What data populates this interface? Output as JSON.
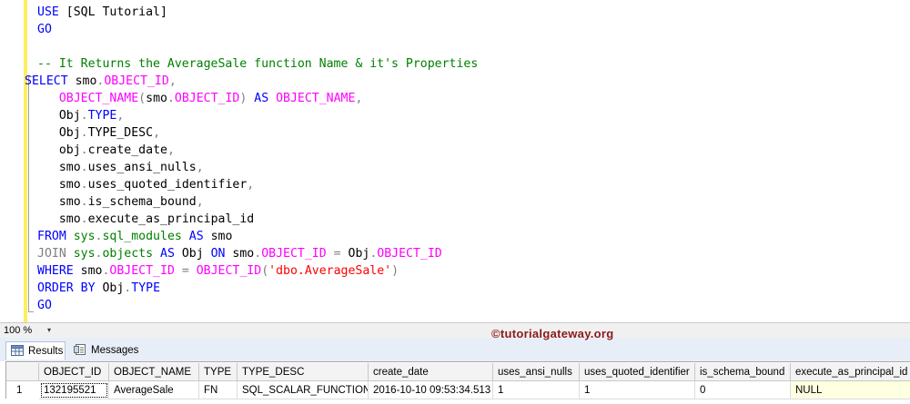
{
  "editor": {
    "lines": [
      {
        "indent": "",
        "tokens": [
          {
            "t": "USE",
            "c": "kw"
          },
          {
            "t": " [SQL Tutorial]",
            "c": "plain"
          }
        ]
      },
      {
        "indent": "",
        "tokens": [
          {
            "t": "GO",
            "c": "kw"
          }
        ]
      },
      {
        "indent": "",
        "tokens": []
      },
      {
        "indent": "",
        "tokens": [
          {
            "t": "-- It Returns the AverageSale function Name & it's Properties",
            "c": "cmt"
          }
        ]
      },
      {
        "indent": "",
        "tokens": [
          {
            "t": "SELECT",
            "c": "kw"
          },
          {
            "t": " smo",
            "c": "plain"
          },
          {
            "t": ".",
            "c": "gray"
          },
          {
            "t": "OBJECT_ID",
            "c": "fn"
          },
          {
            "t": ",",
            "c": "gray"
          }
        ]
      },
      {
        "indent": "   ",
        "tokens": [
          {
            "t": "OBJECT_NAME",
            "c": "fn"
          },
          {
            "t": "(",
            "c": "gray"
          },
          {
            "t": "smo",
            "c": "plain"
          },
          {
            "t": ".",
            "c": "gray"
          },
          {
            "t": "OBJECT_ID",
            "c": "fn"
          },
          {
            "t": ")",
            "c": "gray"
          },
          {
            "t": " AS ",
            "c": "kw"
          },
          {
            "t": "OBJECT_NAME",
            "c": "fn"
          },
          {
            "t": ",",
            "c": "gray"
          }
        ]
      },
      {
        "indent": "   ",
        "tokens": [
          {
            "t": "Obj",
            "c": "plain"
          },
          {
            "t": ".",
            "c": "gray"
          },
          {
            "t": "TYPE",
            "c": "kw"
          },
          {
            "t": ",",
            "c": "gray"
          }
        ]
      },
      {
        "indent": "   ",
        "tokens": [
          {
            "t": "Obj",
            "c": "plain"
          },
          {
            "t": ".",
            "c": "gray"
          },
          {
            "t": "TYPE_DESC",
            "c": "plain"
          },
          {
            "t": ",",
            "c": "gray"
          }
        ]
      },
      {
        "indent": "   ",
        "tokens": [
          {
            "t": "obj",
            "c": "plain"
          },
          {
            "t": ".",
            "c": "gray"
          },
          {
            "t": "create_date",
            "c": "plain"
          },
          {
            "t": ",",
            "c": "gray"
          }
        ]
      },
      {
        "indent": "   ",
        "tokens": [
          {
            "t": "smo",
            "c": "plain"
          },
          {
            "t": ".",
            "c": "gray"
          },
          {
            "t": "uses_ansi_nulls",
            "c": "plain"
          },
          {
            "t": ",",
            "c": "gray"
          }
        ]
      },
      {
        "indent": "   ",
        "tokens": [
          {
            "t": "smo",
            "c": "plain"
          },
          {
            "t": ".",
            "c": "gray"
          },
          {
            "t": "uses_quoted_identifier",
            "c": "plain"
          },
          {
            "t": ",",
            "c": "gray"
          }
        ]
      },
      {
        "indent": "   ",
        "tokens": [
          {
            "t": "smo",
            "c": "plain"
          },
          {
            "t": ".",
            "c": "gray"
          },
          {
            "t": "is_schema_bound",
            "c": "plain"
          },
          {
            "t": ",",
            "c": "gray"
          }
        ]
      },
      {
        "indent": "   ",
        "tokens": [
          {
            "t": "smo",
            "c": "plain"
          },
          {
            "t": ".",
            "c": "gray"
          },
          {
            "t": "execute_as_principal_id",
            "c": "plain"
          }
        ]
      },
      {
        "indent": "",
        "tokens": [
          {
            "t": "FROM ",
            "c": "kw"
          },
          {
            "t": "sys",
            "c": "sys"
          },
          {
            "t": ".",
            "c": "gray"
          },
          {
            "t": "sql_modules",
            "c": "sys"
          },
          {
            "t": " AS ",
            "c": "kw"
          },
          {
            "t": "smo",
            "c": "plain"
          }
        ]
      },
      {
        "indent": "",
        "tokens": [
          {
            "t": "JOIN ",
            "c": "gray"
          },
          {
            "t": "sys",
            "c": "sys"
          },
          {
            "t": ".",
            "c": "gray"
          },
          {
            "t": "objects",
            "c": "sys"
          },
          {
            "t": " AS ",
            "c": "kw"
          },
          {
            "t": "Obj ",
            "c": "plain"
          },
          {
            "t": "ON ",
            "c": "kw"
          },
          {
            "t": "smo",
            "c": "plain"
          },
          {
            "t": ".",
            "c": "gray"
          },
          {
            "t": "OBJECT_ID",
            "c": "fn"
          },
          {
            "t": " = ",
            "c": "gray"
          },
          {
            "t": "Obj",
            "c": "plain"
          },
          {
            "t": ".",
            "c": "gray"
          },
          {
            "t": "OBJECT_ID",
            "c": "fn"
          }
        ]
      },
      {
        "indent": "",
        "tokens": [
          {
            "t": "WHERE ",
            "c": "kw"
          },
          {
            "t": "smo",
            "c": "plain"
          },
          {
            "t": ".",
            "c": "gray"
          },
          {
            "t": "OBJECT_ID",
            "c": "fn"
          },
          {
            "t": " = ",
            "c": "gray"
          },
          {
            "t": "OBJECT_ID",
            "c": "fn"
          },
          {
            "t": "(",
            "c": "gray"
          },
          {
            "t": "'dbo.AverageSale'",
            "c": "str"
          },
          {
            "t": ")",
            "c": "gray"
          }
        ]
      },
      {
        "indent": "",
        "tokens": [
          {
            "t": "ORDER BY ",
            "c": "kw"
          },
          {
            "t": "Obj",
            "c": "plain"
          },
          {
            "t": ".",
            "c": "gray"
          },
          {
            "t": "TYPE",
            "c": "kw"
          }
        ]
      },
      {
        "indent": "",
        "tokens": [
          {
            "t": "GO",
            "c": "kw"
          }
        ]
      }
    ]
  },
  "zoom": {
    "value": "100 %",
    "arrow": "▾"
  },
  "watermark": "©tutorialgateway.org",
  "tabs": {
    "results": "Results",
    "messages": "Messages"
  },
  "grid": {
    "columns": [
      "OBJECT_ID",
      "OBJECT_NAME",
      "TYPE",
      "TYPE_DESC",
      "create_date",
      "uses_ansi_nulls",
      "uses_quoted_identifier",
      "is_schema_bound",
      "execute_as_principal_id"
    ],
    "rows": [
      {
        "num": "1",
        "cells": [
          "132195521",
          "AverageSale",
          "FN",
          "SQL_SCALAR_FUNCTION",
          "2016-10-10 09:53:34.513",
          "1",
          "1",
          "0",
          "NULL"
        ]
      }
    ]
  },
  "colors": {
    "keyword": "#0000ff",
    "function": "#ff00ff",
    "system": "#008000",
    "string": "#ff0000",
    "operator": "#808080",
    "comment": "#008000",
    "change_bar": "#ffee62"
  }
}
